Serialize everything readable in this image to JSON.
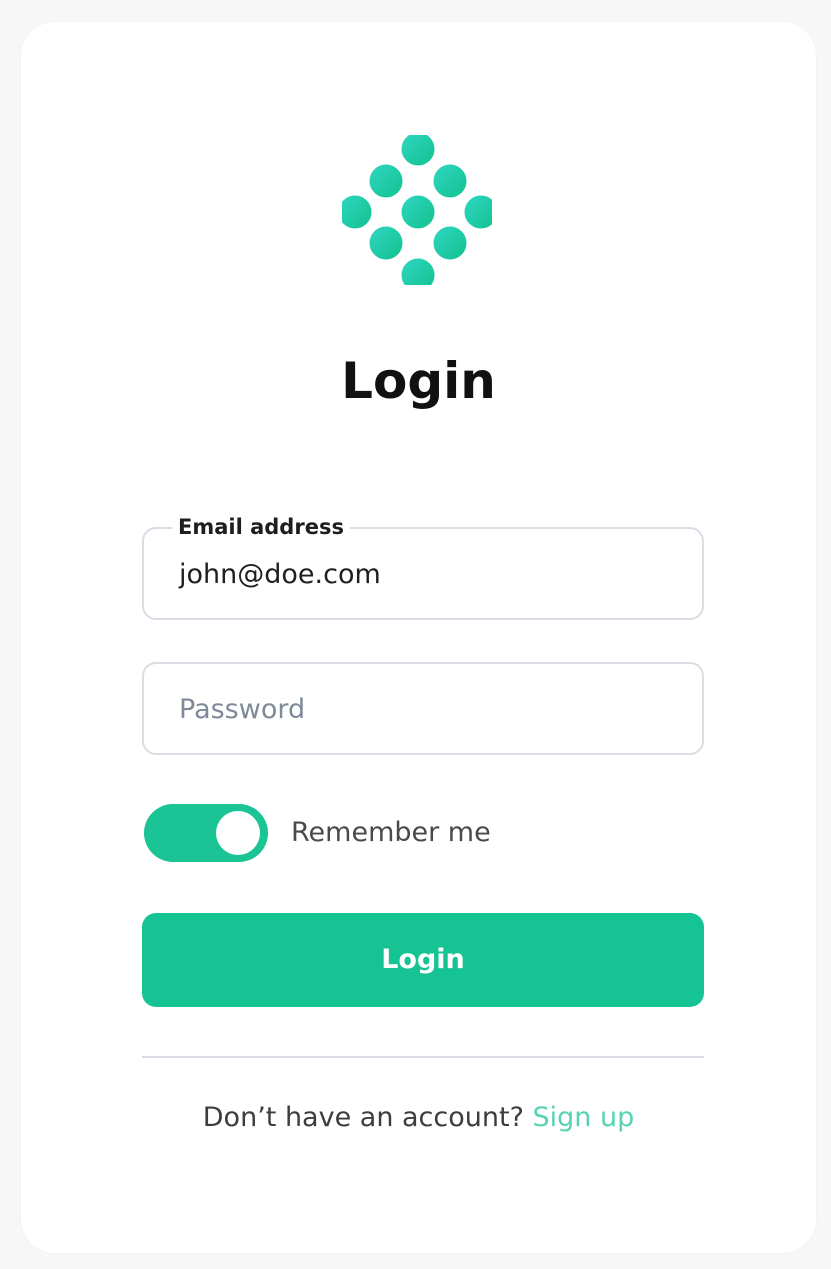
{
  "brand": {
    "accent": "#16c493",
    "logo_icon": "molecule-dots-icon"
  },
  "login": {
    "title": "Login",
    "email": {
      "label": "Email address",
      "value": "john@doe.com"
    },
    "password": {
      "placeholder": "Password"
    },
    "remember": {
      "label": "Remember me",
      "checked": true
    },
    "button_label": "Login",
    "signup_prompt": "Don’t have an account?",
    "signup_link": "Sign up"
  }
}
